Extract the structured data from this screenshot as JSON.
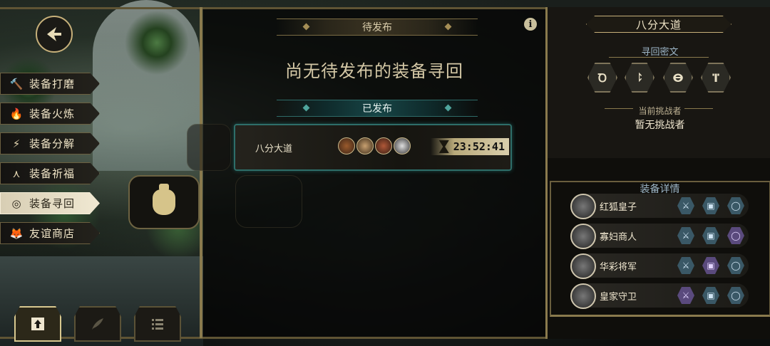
{
  "left_menu": {
    "items": [
      {
        "label": "装备打磨",
        "icon": "hammer-icon",
        "glyph": "🔨",
        "active": false
      },
      {
        "label": "装备火炼",
        "icon": "flame-icon",
        "glyph": "🔥",
        "active": false
      },
      {
        "label": "装备分解",
        "icon": "lightning-icon",
        "glyph": "⚡",
        "active": false
      },
      {
        "label": "装备祈福",
        "icon": "blessing-icon",
        "glyph": "⋏",
        "active": false
      },
      {
        "label": "装备寻回",
        "icon": "target-icon",
        "glyph": "◎",
        "active": true
      },
      {
        "label": "友谊商店",
        "icon": "fox-icon",
        "glyph": "🦊",
        "active": false
      }
    ]
  },
  "center": {
    "pending_header": "待发布",
    "empty_message": "尚无待发布的装备寻回",
    "published_header": "已发布",
    "entry": {
      "name": "八分大道",
      "timer": "23:52:41"
    }
  },
  "right_panel": {
    "title": "八分大道",
    "secret_label": "寻回密文",
    "runes": [
      "Ꝺ",
      "⥏",
      "ⴱ",
      "ⴶ"
    ],
    "challenger_label": "当前挑战者",
    "challenger_value": "暂无挑战者",
    "details_label": "装备详情",
    "characters": [
      {
        "name": "红狐皇子",
        "weapon": "blue",
        "armor": "blue",
        "ring": "blue"
      },
      {
        "name": "寡妇商人",
        "weapon": "blue",
        "armor": "blue",
        "ring": "purple"
      },
      {
        "name": "华彩将军",
        "weapon": "blue",
        "armor": "purple",
        "ring": "blue"
      },
      {
        "name": "皇家守卫",
        "weapon": "purple",
        "armor": "blue",
        "ring": "blue"
      }
    ]
  },
  "colors": {
    "gold": "#c7b07a",
    "teal": "#2e6e69",
    "blue_gear": "#3a5866",
    "purple_gear": "#5a4a7d"
  }
}
